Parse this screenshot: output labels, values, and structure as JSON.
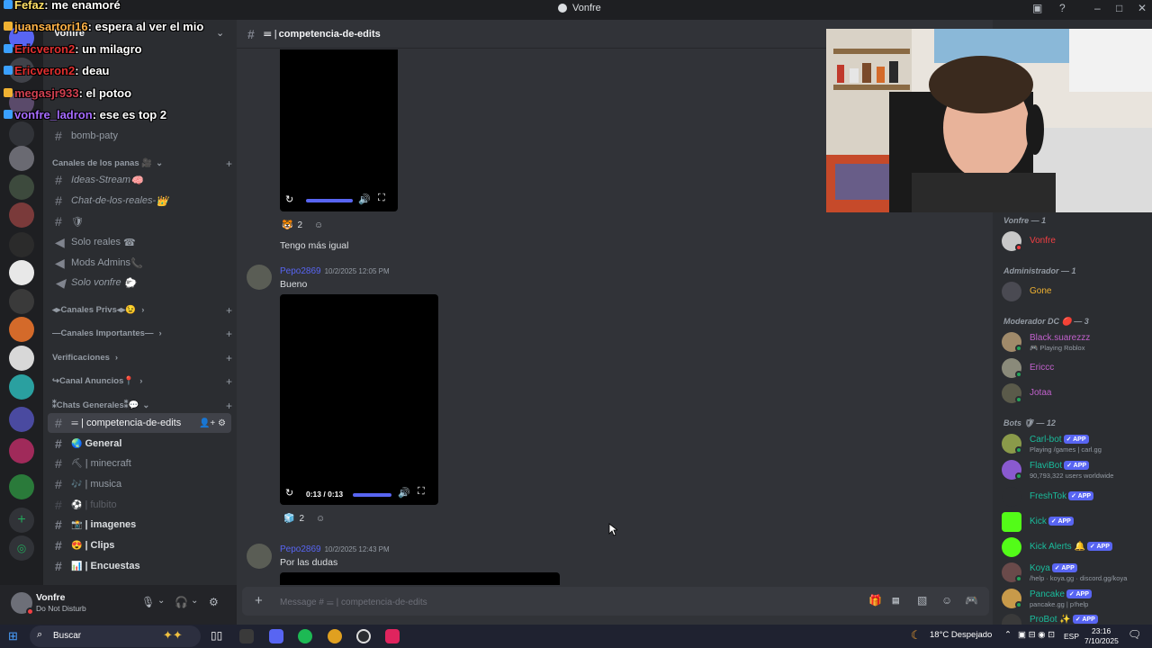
{
  "window": {
    "title": "Vonfre"
  },
  "overlay_chat": [
    {
      "user": "Fefaz",
      "text": ": me enamoré",
      "color": "#ffe066"
    },
    {
      "user": "juansartori16",
      "text": ": espera al ver el mio",
      "color": "#ffb347"
    },
    {
      "user": "Ericveron2",
      "text": ": un milagro",
      "color": "#e03030"
    },
    {
      "user": "Ericveron2",
      "text": ": deau",
      "color": "#e03030"
    },
    {
      "user": "megasjr933",
      "text": ": el potoo",
      "color": "#d04050"
    },
    {
      "user": "vonfre_ladron",
      "text": ": ese es top 2",
      "color": "#a66cff"
    }
  ],
  "server": {
    "name": "Vonfre"
  },
  "channels": {
    "top": [
      {
        "name": "bomb-paty",
        "emoji": ""
      }
    ],
    "categories": [
      {
        "label": "Canales de los panas 🎥",
        "items": [
          {
            "name": "Ideas-Stream",
            "emoji": "🧠",
            "italic": true,
            "type": "text"
          },
          {
            "name": "Chat-de-los-reales-",
            "emoji": "👑",
            "italic": true,
            "type": "text"
          },
          {
            "name": "",
            "emoji": "🛡",
            "italic": false,
            "type": "text"
          },
          {
            "name": "Solo reales",
            "emoji": "☎",
            "italic": false,
            "type": "voice"
          },
          {
            "name": "Mods Admins",
            "emoji": "📞",
            "italic": false,
            "type": "voice"
          },
          {
            "name": "Solo vonfre",
            "emoji": "🐑",
            "italic": true,
            "type": "voice"
          }
        ]
      },
      {
        "label": "◂▸Canales Privs◂▸😉",
        "items": []
      },
      {
        "label": "—Canales Importantes—",
        "items": []
      },
      {
        "label": "Verificaciones",
        "items": []
      },
      {
        "label": "↪Canal Anuncios📍",
        "items": []
      },
      {
        "label": "⁑Chats Generales⁑💬",
        "items": []
      }
    ],
    "general": [
      {
        "name": "competencia-de-edits",
        "emoji": "𝍢",
        "active": true
      },
      {
        "name": "General",
        "emoji": "🌏",
        "bold": true
      },
      {
        "name": "minecraft",
        "emoji": "⛏",
        "bold": false
      },
      {
        "name": "musica",
        "emoji": "🎶",
        "bold": false
      },
      {
        "name": "fulbito",
        "emoji": "⚽",
        "bold": false,
        "muted": true
      },
      {
        "name": "imagenes",
        "emoji": "📸",
        "bold": true
      },
      {
        "name": "Clips",
        "emoji": "😍",
        "bold": true
      },
      {
        "name": "Encuestas",
        "emoji": "📊",
        "bold": true
      }
    ]
  },
  "user_panel": {
    "name": "Vonfre",
    "status": "Do Not Disturb"
  },
  "chat": {
    "channel_name": "competencia-de-edits",
    "video1": {
      "reaction_count": "2"
    },
    "message1": {
      "text": "Tengo más igual"
    },
    "message2": {
      "author": "Pepo2869",
      "timestamp": "10/2/2025 12:05 PM",
      "text": "Bueno"
    },
    "video2": {
      "time": "0:13 / 0:13",
      "reaction_count": "2"
    },
    "message3": {
      "author": "Pepo2869",
      "timestamp": "10/2/2025 12:43 PM",
      "text": "Por las dudas"
    },
    "input_placeholder": "Message # 𝍢 | competencia-de-edits"
  },
  "members": {
    "groups": [
      {
        "label": "Vonfre — 1",
        "members": [
          {
            "name": "Vonfre",
            "color": "#f23f43",
            "sub": "",
            "app": false
          }
        ]
      },
      {
        "label": "Administrador — 1",
        "members": [
          {
            "name": "Gone",
            "color": "#f0b232",
            "sub": "",
            "app": false
          }
        ]
      },
      {
        "label": "Moderador DC 🔴 — 3",
        "members": [
          {
            "name": "Black.suarezzz",
            "color": "#c061cb",
            "sub": "🎮 Playing Roblox",
            "app": false
          },
          {
            "name": "Ericcc",
            "color": "#c061cb",
            "sub": "",
            "app": false
          },
          {
            "name": "Jotaa",
            "color": "#c061cb",
            "sub": "",
            "app": false
          }
        ]
      },
      {
        "label": "Bots 🛡 — 12",
        "members": [
          {
            "name": "Carl-bot",
            "color": "#1abc9c",
            "sub": "Playing /games | carl.gg",
            "app": true
          },
          {
            "name": "FlaviBot",
            "color": "#1abc9c",
            "sub": "90,793,322 users worldwide",
            "app": true
          },
          {
            "name": "FreshTok",
            "color": "#1abc9c",
            "sub": "",
            "app": true
          },
          {
            "name": "Kick",
            "color": "#1abc9c",
            "sub": "",
            "app": true
          },
          {
            "name": "Kick Alerts 🔔",
            "color": "#1abc9c",
            "sub": "",
            "app": true
          },
          {
            "name": "Koya",
            "color": "#1abc9c",
            "sub": "/help · koya.gg · discord.gg/koya",
            "app": true
          },
          {
            "name": "Pancake",
            "color": "#1abc9c",
            "sub": "pancake.gg | p!help",
            "app": true
          },
          {
            "name": "ProBot ✨",
            "color": "#1abc9c",
            "sub": "",
            "app": true
          }
        ]
      }
    ],
    "app_badge": "✓ APP"
  },
  "taskbar": {
    "search_placeholder": "Buscar",
    "weather": "18°C  Despejado",
    "language": "ESP",
    "time": "23:16",
    "date": "7/10/2025"
  }
}
